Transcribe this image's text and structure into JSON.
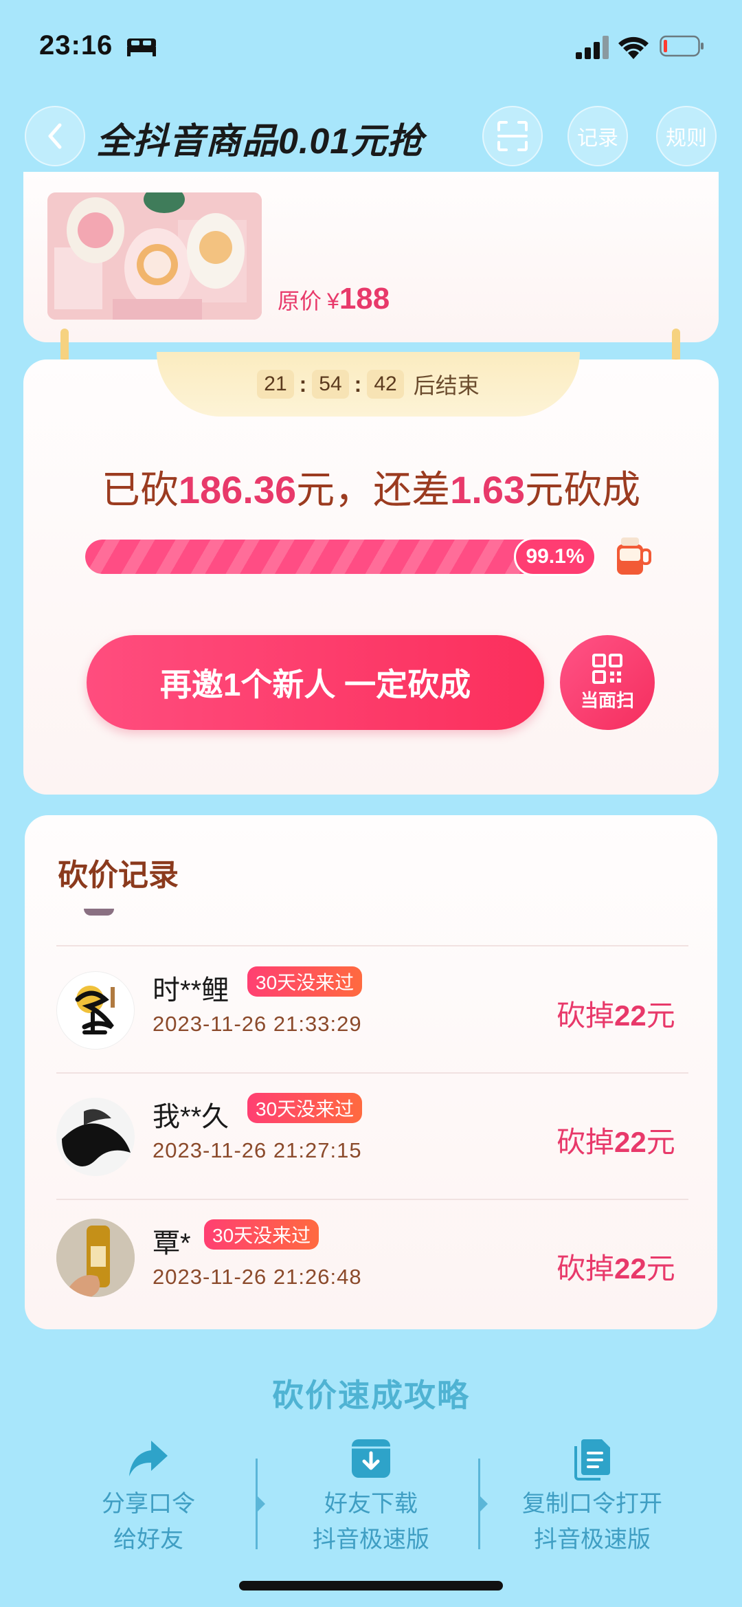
{
  "status_bar": {
    "time": "23:16"
  },
  "header": {
    "title": "全抖音商品0.01元抢",
    "record_label": "记录",
    "rules_label": "规则"
  },
  "product": {
    "orig_label": "原价",
    "currency": "¥",
    "orig_price": "188"
  },
  "timer": {
    "h": "21",
    "m": "54",
    "s": "42",
    "sep": ":",
    "suffix": "后结束"
  },
  "summary": {
    "prefix": "已砍",
    "cut": "186.36",
    "mid": "元，还差",
    "remain": "1.63",
    "suffix": "元砍成"
  },
  "progress": {
    "percent_label": "99.1%",
    "fraction": 0.991
  },
  "actions": {
    "invite_label": "再邀1个新人 一定砍成",
    "facescan_label": "当面扫"
  },
  "records": {
    "title": "砍价记录",
    "items": [
      {
        "name": "时**鲤",
        "badge": "30天没来过",
        "time": "2023-11-26 21:33:29",
        "amount_prefix": "砍掉",
        "amount": "22",
        "amount_suffix": "元"
      },
      {
        "name": "我**久",
        "badge": "30天没来过",
        "time": "2023-11-26 21:27:15",
        "amount_prefix": "砍掉",
        "amount": "22",
        "amount_suffix": "元"
      },
      {
        "name": "覃*",
        "badge": "30天没来过",
        "time": "2023-11-26 21:26:48",
        "amount_prefix": "砍掉",
        "amount": "22",
        "amount_suffix": "元"
      }
    ]
  },
  "tips": {
    "title": "砍价速成攻略",
    "steps": [
      {
        "line1": "分享口令",
        "line2": "给好友",
        "icon": "share-icon"
      },
      {
        "line1": "好友下载",
        "line2": "抖音极速版",
        "icon": "download-icon"
      },
      {
        "line1": "复制口令打开",
        "line2": "抖音极速版",
        "icon": "document-icon"
      }
    ]
  },
  "colors": {
    "background": "#a8e6fb",
    "accent": "#e8396a",
    "brown": "#9b3b20",
    "tips": "#3f9ec3"
  }
}
